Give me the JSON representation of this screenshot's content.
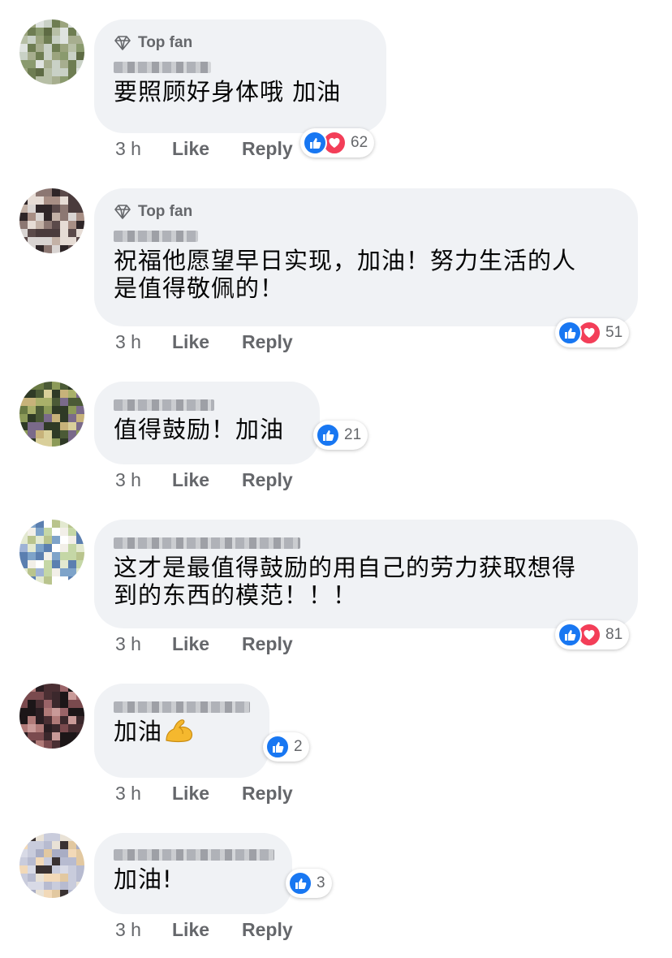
{
  "colors": {
    "bubble_bg": "#f0f2f5",
    "meta_text": "#65676b",
    "like_blue": "#1877f2",
    "love_red": "#f33e58"
  },
  "comments": [
    {
      "badge": "Top fan",
      "text_lines": [
        "要照顾好身体哦  加油"
      ],
      "reactions": [
        "like",
        "love"
      ],
      "reaction_count": "62",
      "time": "3 h",
      "like_label": "Like",
      "reply_label": "Reply"
    },
    {
      "badge": "Top fan",
      "text_lines": [
        "祝福他愿望早日实现，加油！努力生活的人",
        "是值得敬佩的！"
      ],
      "reactions": [
        "like",
        "love"
      ],
      "reaction_count": "51",
      "time": "3 h",
      "like_label": "Like",
      "reply_label": "Reply"
    },
    {
      "text_lines": [
        "值得鼓励！加油"
      ],
      "reactions": [
        "like"
      ],
      "reaction_count": "21",
      "time": "3 h",
      "like_label": "Like",
      "reply_label": "Reply"
    },
    {
      "text_lines": [
        "这才是最值得鼓励的用自己的劳力获取想得",
        "到的东西的模范！！！"
      ],
      "reactions": [
        "like",
        "love"
      ],
      "reaction_count": "81",
      "time": "3 h",
      "like_label": "Like",
      "reply_label": "Reply"
    },
    {
      "text_lines": [
        "加油"
      ],
      "emoji": "flexed-biceps-icon",
      "reactions": [
        "like"
      ],
      "reaction_count": "2",
      "time": "3 h",
      "like_label": "Like",
      "reply_label": "Reply"
    },
    {
      "text_lines": [
        "加油!"
      ],
      "reactions": [
        "like"
      ],
      "reaction_count": "3",
      "time": "3 h",
      "like_label": "Like",
      "reply_label": "Reply"
    }
  ]
}
